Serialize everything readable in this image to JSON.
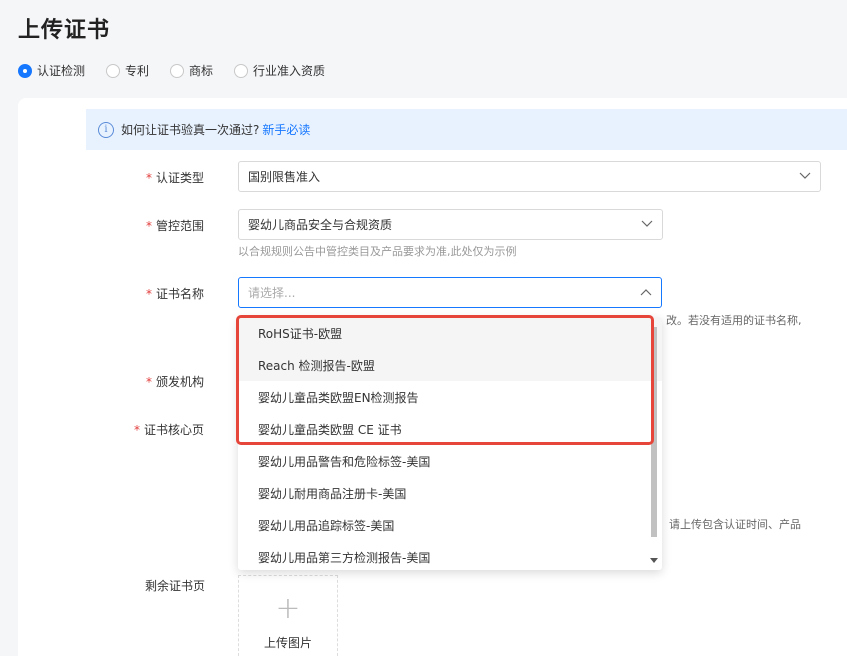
{
  "page": {
    "title": "上传证书"
  },
  "radios": [
    {
      "label": "认证检测",
      "checked": true
    },
    {
      "label": "专利",
      "checked": false
    },
    {
      "label": "商标",
      "checked": false
    },
    {
      "label": "行业准入资质",
      "checked": false
    }
  ],
  "notice": {
    "text": "如何让证书验真一次通过?",
    "link": "新手必读"
  },
  "form": {
    "cert_type": {
      "label": "认证类型",
      "value": "国别限售准入"
    },
    "scope": {
      "label": "管控范围",
      "value": "婴幼儿商品安全与合规资质",
      "hint": "以合规规则公告中管控类目及产品要求为准,此处仅为示例"
    },
    "cert_name": {
      "label": "证书名称",
      "placeholder": "请选择...",
      "hint_partial": "改。若没有适用的证书名称,"
    },
    "issuer": {
      "label": "颁发机构"
    },
    "core_page": {
      "label": "证书核心页",
      "hint_partial": "请上传包含认证时间、产品"
    },
    "rest_pages": {
      "label": "剩余证书页",
      "upload_label": "上传图片"
    }
  },
  "dropdown": {
    "options": [
      "RoHS证书-欧盟",
      "Reach 检测报告-欧盟",
      "婴幼儿童品类欧盟EN检测报告",
      "婴幼儿童品类欧盟 CE 证书",
      "婴幼儿用品警告和危险标签-美国",
      "婴幼儿耐用商品注册卡-美国",
      "婴幼儿用品追踪标签-美国",
      "婴幼儿用品第三方检测报告-美国"
    ]
  },
  "colors": {
    "accent": "#1677ff",
    "required": "#e23c3c",
    "highlight_box": "#e6453a",
    "notice_bg": "#e8f2ff"
  }
}
